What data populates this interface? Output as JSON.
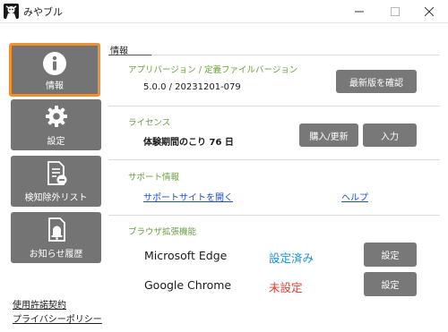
{
  "window": {
    "title": "みやブル"
  },
  "colors": {
    "accent_border": "#f2902d",
    "sidebar_button": "#747474",
    "section_label": "#6a9f3d",
    "status_ok": "#1e8fd0",
    "status_ng": "#e23b2e",
    "link": "#1a4fd6",
    "button": "#787878"
  },
  "sidebar": {
    "items": [
      {
        "label": "情報",
        "icon": "info-icon",
        "active": true
      },
      {
        "label": "設定",
        "icon": "gear-icon",
        "active": false
      },
      {
        "label": "検知除外リスト",
        "icon": "document-minus-icon",
        "active": false
      },
      {
        "label": "お知らせ履歴",
        "icon": "bell-document-icon",
        "active": false
      }
    ],
    "links": [
      {
        "label": "使用許諾契約"
      },
      {
        "label": "プライバシーポリシー"
      }
    ]
  },
  "main": {
    "title": "情報",
    "app_version": {
      "label": "アプリバージョン / 定義ファイルバージョン",
      "value": "5.0.0 / 20231201-079",
      "check_button": "最新版を確認"
    },
    "license": {
      "label": "ライセンス",
      "value": "体験期間のこり 76 日",
      "purchase_button": "購入/更新",
      "input_button": "入力"
    },
    "support": {
      "label": "サポート情報",
      "site_link": "サポートサイトを開く",
      "help_link": "ヘルプ"
    },
    "browser_ext": {
      "label": "ブラウザ拡張機能",
      "browsers": [
        {
          "name": "Microsoft Edge",
          "status": "設定済み",
          "button": "設定"
        },
        {
          "name": "Google Chrome",
          "status": "未設定",
          "button": "設定"
        }
      ]
    }
  }
}
